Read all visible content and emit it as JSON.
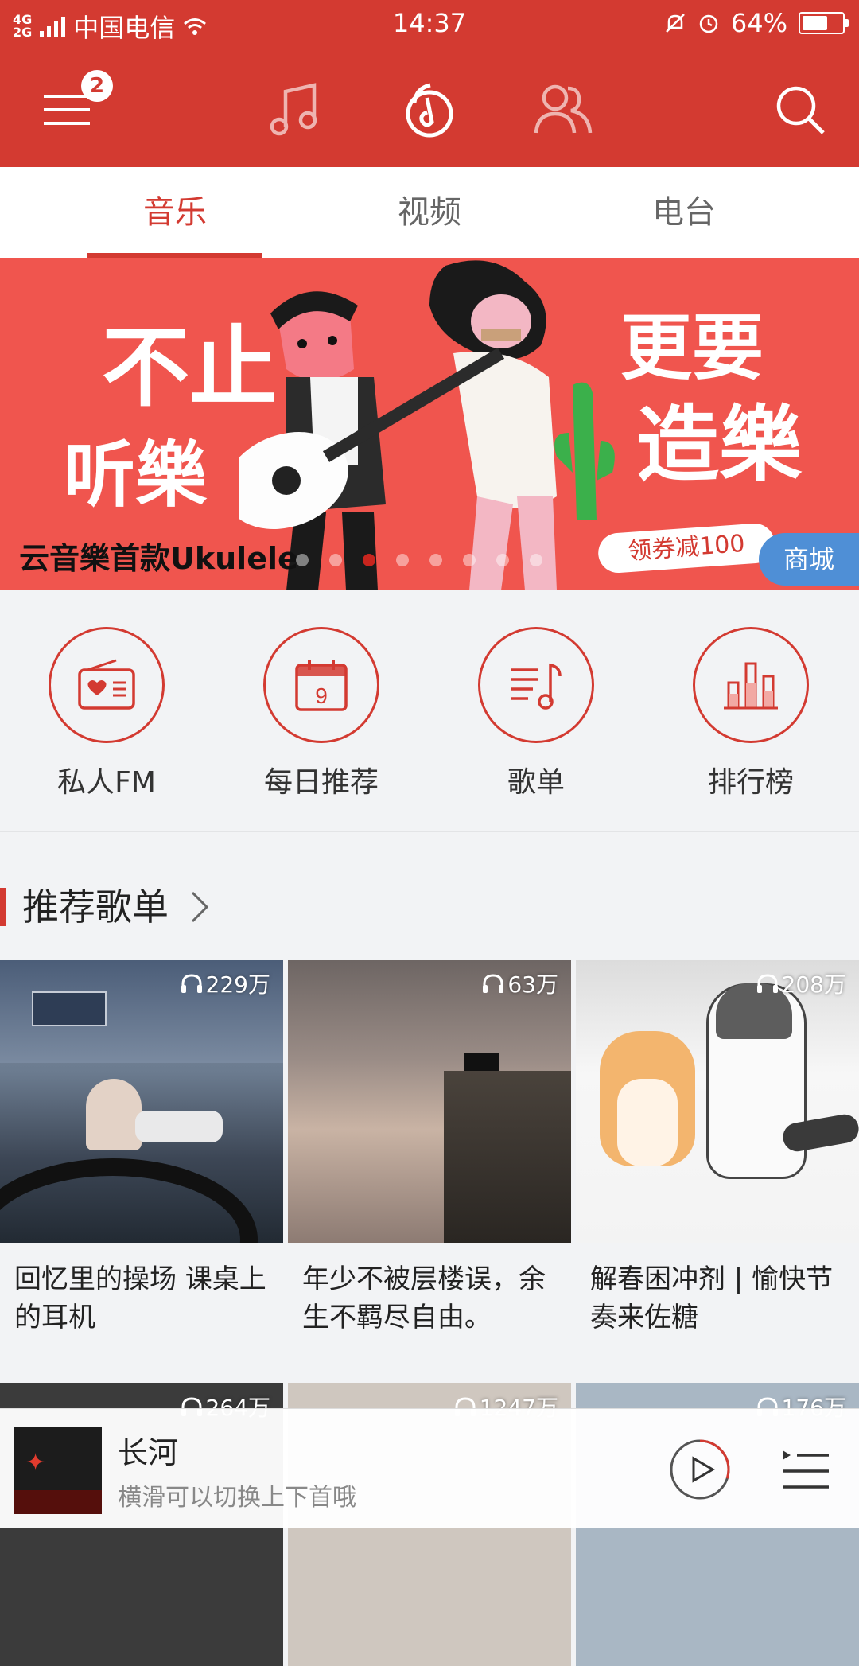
{
  "status_bar": {
    "network": "4G 2G",
    "carrier": "中国电信",
    "time": "14:37",
    "battery": "64%",
    "battery_level": 0.64
  },
  "top_nav": {
    "menu_badge": "2",
    "icons": [
      "menu-icon",
      "music-note-icon",
      "discover-icon",
      "friends-icon",
      "search-icon"
    ]
  },
  "tabs": [
    {
      "label": "音乐",
      "active": true
    },
    {
      "label": "视频",
      "active": false
    },
    {
      "label": "电台",
      "active": false
    }
  ],
  "banner": {
    "headline_left_1": "不止",
    "headline_left_2": "听樂",
    "headline_right_1": "更要",
    "headline_right_2": "造樂",
    "caption": "云音樂首款Ukulele",
    "coupon": "领券减100",
    "tag": "商城",
    "dot_count": 8,
    "active_dot": 2
  },
  "shortcuts": [
    {
      "label": "私人FM",
      "icon": "radio-heart-icon"
    },
    {
      "label": "每日推荐",
      "icon": "calendar-icon",
      "calendar_day": "9"
    },
    {
      "label": "歌单",
      "icon": "playlist-note-icon"
    },
    {
      "label": "排行榜",
      "icon": "bar-chart-icon"
    }
  ],
  "section": {
    "title": "推荐歌单"
  },
  "playlists": [
    {
      "plays": "229万",
      "name": "回忆里的操场 课桌上的耳机"
    },
    {
      "plays": "63万",
      "name": "年少不被层楼误，余生不羁尽自由。"
    },
    {
      "plays": "208万",
      "name": "解春困冲剂 | 愉快节奏来佐糖"
    },
    {
      "plays": "264万",
      "name": ""
    },
    {
      "plays": "1247万",
      "name": ""
    },
    {
      "plays": "176万",
      "name": ""
    }
  ],
  "player": {
    "song": "长河",
    "hint": "横滑可以切换上下首哦",
    "progress": 0.3
  },
  "colors": {
    "brand_red": "#d33a31",
    "banner_bg": "#f0554e",
    "shop_blue": "#4f8fd6"
  }
}
